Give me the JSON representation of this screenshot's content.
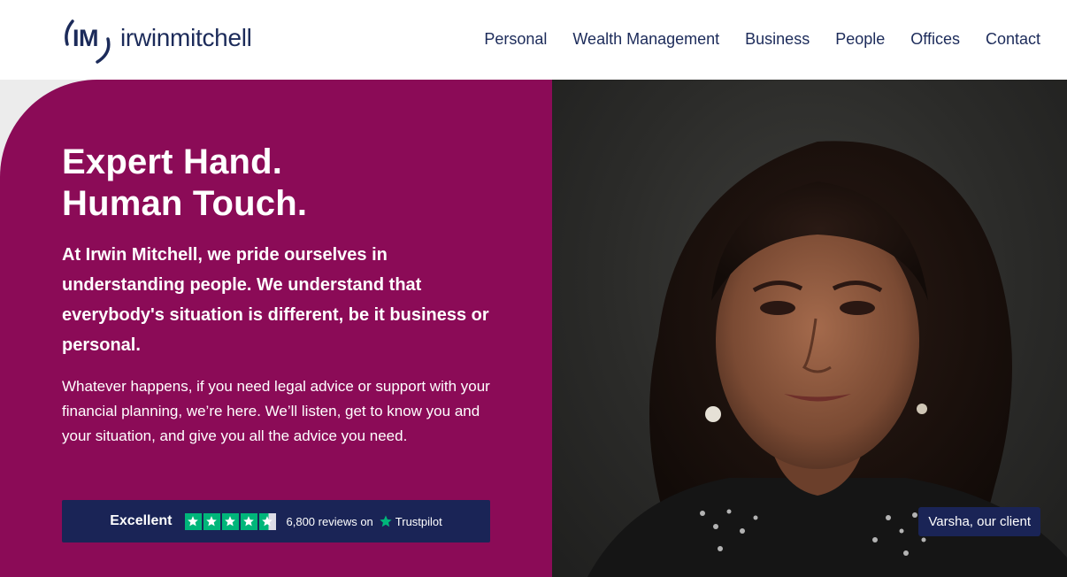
{
  "brand": {
    "logo_mark_text": "IM",
    "logo_wordmark": "irwinmitchell",
    "primary_color": "#1c2b5a",
    "accent_color": "#8b0b57"
  },
  "nav": {
    "items": [
      {
        "label": "Personal"
      },
      {
        "label": "Wealth Management"
      },
      {
        "label": "Business"
      },
      {
        "label": "People"
      },
      {
        "label": "Offices"
      },
      {
        "label": "Contact"
      }
    ]
  },
  "hero": {
    "headline_line1": "Expert Hand.",
    "headline_line2": "Human Touch.",
    "lead": "At Irwin Mitchell, we pride ourselves in understanding people. We understand that everybody's situation is different, be it business or personal.",
    "body": "Whatever happens, if you need legal advice or support with your financial planning, we’re here. We’ll listen, get to know you and your situation, and give you all the advice you need.",
    "photo_caption": "Varsha, our client"
  },
  "trustpilot": {
    "rating_label": "Excellent",
    "stars": 4.5,
    "reviews_text": "6,800 reviews on",
    "brand_name": "Trustpilot",
    "star_color": "#00b67a"
  }
}
